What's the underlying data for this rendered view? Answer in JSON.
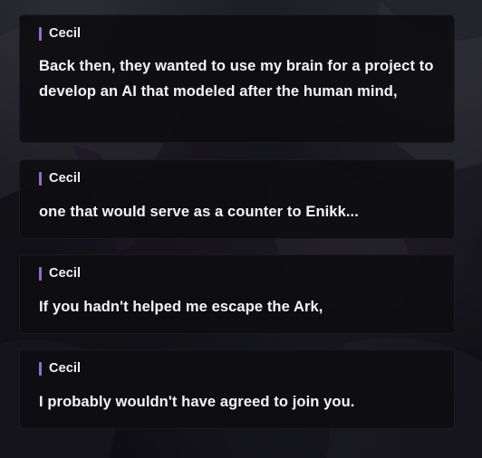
{
  "dialogue_log": {
    "entries": [
      {
        "speaker": "Cecil",
        "text": "Back then, they wanted to use my brain for a project to develop an AI that modeled after the human mind,"
      },
      {
        "speaker": "Cecil",
        "text": "one that would serve as a counter to Enikk..."
      },
      {
        "speaker": "Cecil",
        "text": "If you hadn't helped me escape the Ark,"
      },
      {
        "speaker": "Cecil",
        "text": "I probably wouldn't have agreed to join you."
      }
    ],
    "speaker_marker_color": "#8f6be8"
  }
}
